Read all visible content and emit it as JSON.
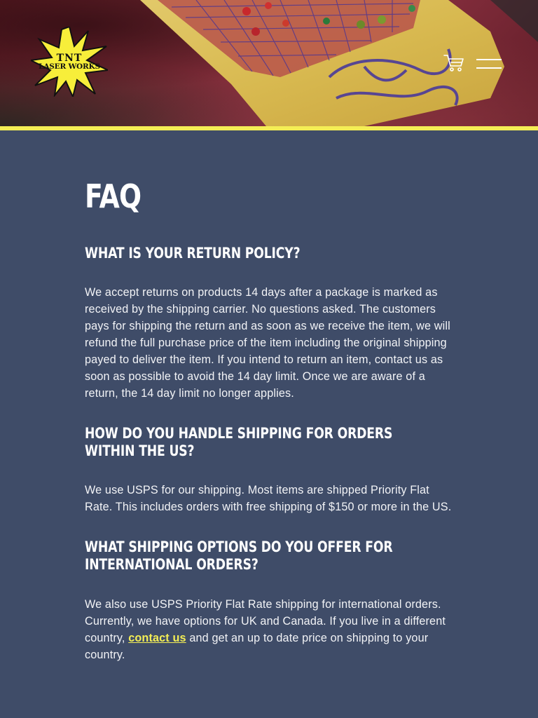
{
  "brand": {
    "logo_line1": "TNT",
    "logo_line2": "LASER WORKS",
    "accent": "#f4ee55",
    "background": "#3f4c68"
  },
  "header": {
    "cart_icon": "shopping-cart-icon",
    "menu_icon": "hamburger-menu-icon"
  },
  "page": {
    "title": "FAQ"
  },
  "faq": [
    {
      "question": "What is your return policy?",
      "answer": "We accept returns on products 14 days after a package is marked as received by the shipping carrier. No questions asked. The customers pays for shipping the return and as soon as we receive the item, we will refund the full purchase price of the item including the original shipping payed to deliver the item. If you intend to return an item, contact us as soon as possible to avoid the 14 day limit. Once we are aware of a return, the 14 day limit no longer applies."
    },
    {
      "question": "How do you handle shipping for orders within the US?",
      "answer": "We use USPS for our shipping. Most items are shipped Priority Flat Rate. This includes orders with free shipping of $150 or more in the US."
    },
    {
      "question": "What shipping options do you offer for international orders?",
      "answer_before": "We also use USPS Priority Flat Rate shipping for international orders. Currently, we have options for UK and Canada. If you live in a different country, ",
      "answer_link": "contact us",
      "answer_after": " and get an up to date price on shipping to your country."
    }
  ]
}
